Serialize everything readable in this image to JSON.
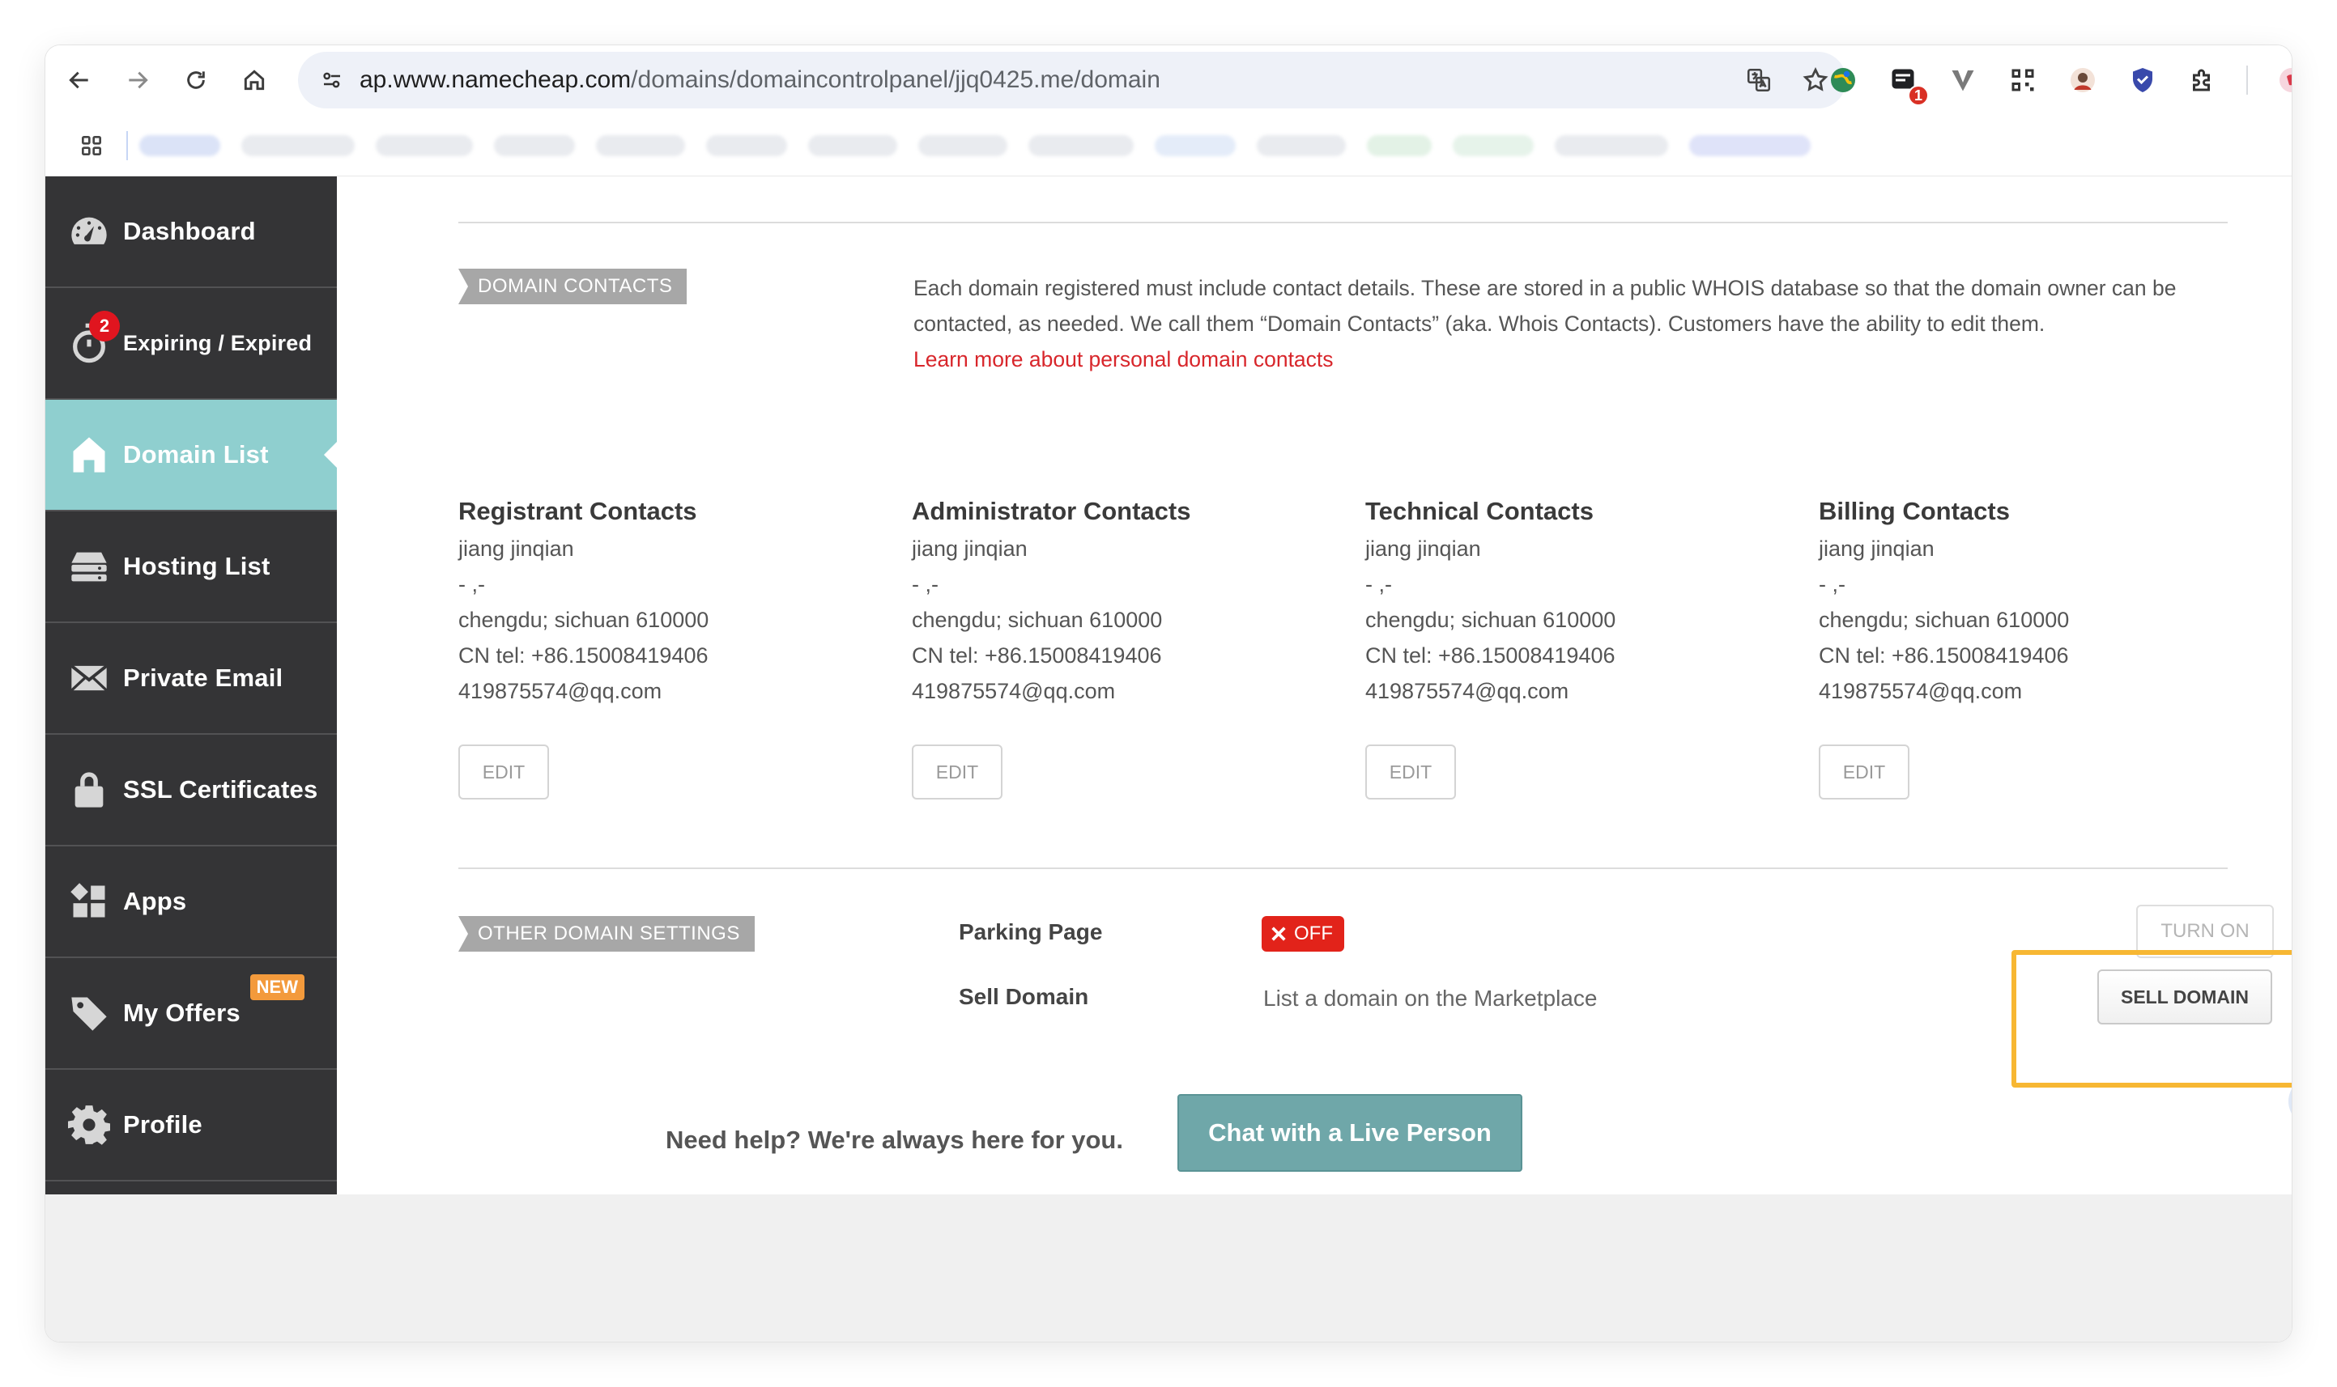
{
  "browser": {
    "url_host": "ap.www.namecheap.com",
    "url_path": "/domains/domaincontrolpanel/jjq0425.me/domain",
    "extension_badge": "1"
  },
  "sidebar": {
    "items": [
      {
        "label": "Dashboard",
        "icon": "dashboard-gauge-icon"
      },
      {
        "label": "Expiring / Expired",
        "icon": "stopwatch-icon",
        "badge": "2"
      },
      {
        "label": "Domain List",
        "icon": "home-icon",
        "active": true
      },
      {
        "label": "Hosting List",
        "icon": "server-icon"
      },
      {
        "label": "Private Email",
        "icon": "envelope-icon"
      },
      {
        "label": "SSL Certificates",
        "icon": "lock-icon"
      },
      {
        "label": "Apps",
        "icon": "apps-icon"
      },
      {
        "label": "My Offers",
        "icon": "tag-icon",
        "badge": "NEW"
      },
      {
        "label": "Profile",
        "icon": "gear-icon"
      }
    ]
  },
  "domain_contacts": {
    "tag": "DOMAIN CONTACTS",
    "description": "Each domain registered must include contact details. These are stored in a public WHOIS database so that the domain owner can be contacted, as needed. We call them “Domain Contacts” (aka. Whois Contacts). Customers have the ability to edit them.",
    "learn_more": "Learn more about personal domain contacts",
    "columns": [
      {
        "title": "Registrant Contacts",
        "name": "jiang jinqian",
        "line2": "- ,-",
        "city": "chengdu; sichuan 610000",
        "phone": "CN tel: +86.15008419406",
        "email": "419875574@qq.com",
        "edit": "EDIT"
      },
      {
        "title": "Administrator Contacts",
        "name": "jiang jinqian",
        "line2": "- ,-",
        "city": "chengdu; sichuan 610000",
        "phone": "CN tel: +86.15008419406",
        "email": "419875574@qq.com",
        "edit": "EDIT"
      },
      {
        "title": "Technical Contacts",
        "name": "jiang jinqian",
        "line2": "- ,-",
        "city": "chengdu; sichuan 610000",
        "phone": "CN tel: +86.15008419406",
        "email": "419875574@qq.com",
        "edit": "EDIT"
      },
      {
        "title": "Billing Contacts",
        "name": "jiang jinqian",
        "line2": "- ,-",
        "city": "chengdu; sichuan 610000",
        "phone": "CN tel: +86.15008419406",
        "email": "419875574@qq.com",
        "edit": "EDIT"
      }
    ]
  },
  "other_settings": {
    "tag": "OTHER DOMAIN SETTINGS",
    "parking_label": "Parking Page",
    "parking_status": "OFF",
    "turn_on": "TURN ON",
    "sell_label": "Sell Domain",
    "sell_desc": "List a domain on the Marketplace",
    "sell_button": "SELL DOMAIN"
  },
  "footer": {
    "help_text": "Need help? We're always here for you.",
    "chat_button": "Chat with a Live Person"
  },
  "colors": {
    "sidebar_bg": "#343436",
    "active_item": "#8fcfcf",
    "accent_red": "#d8262b",
    "highlight": "#f7b733",
    "chat_button": "#6fa7a9"
  }
}
